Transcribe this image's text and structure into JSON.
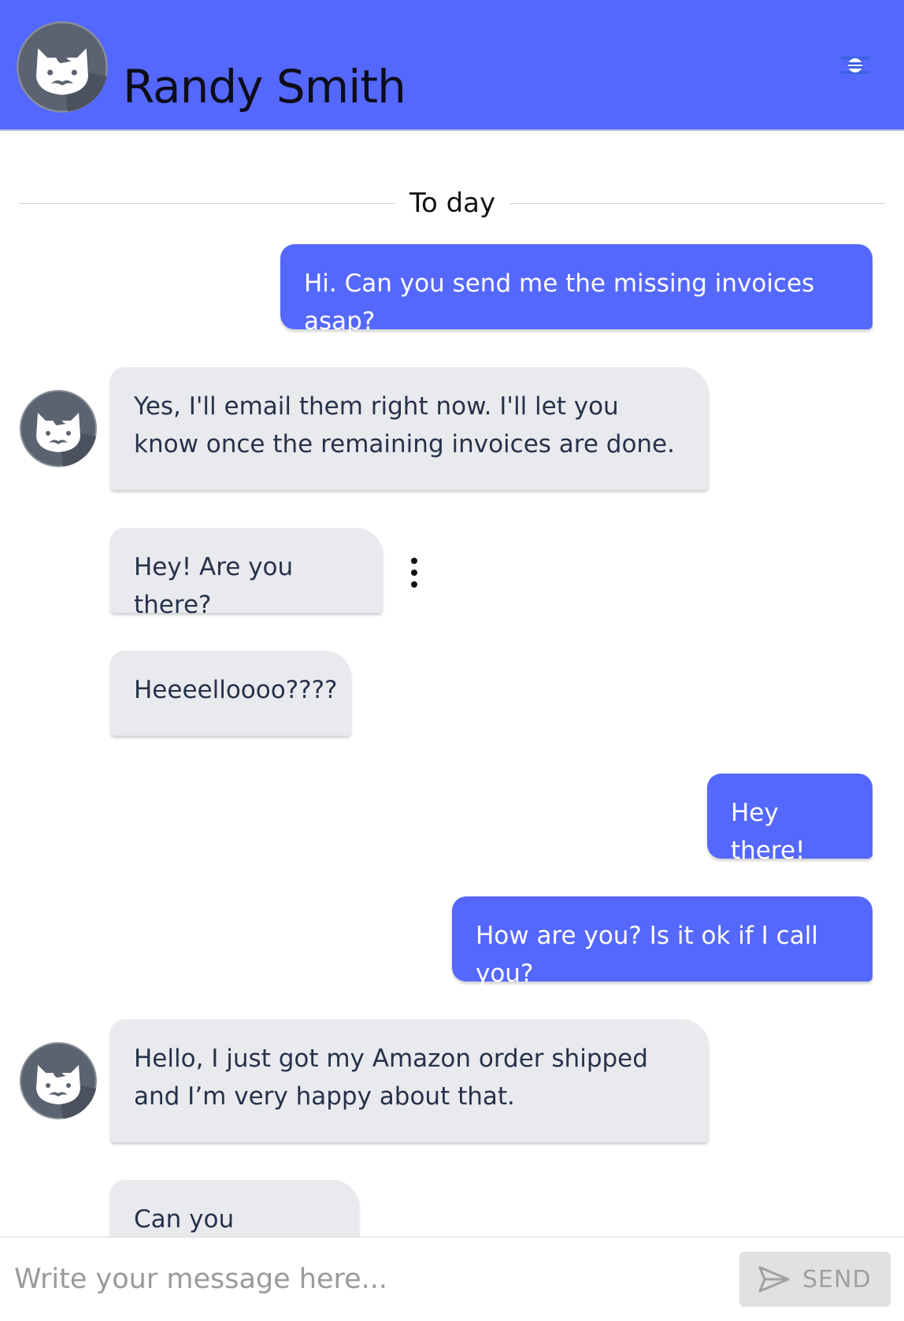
{
  "header": {
    "contact_name": "Randy Smith",
    "avatar_icon": "cat-mustache-avatar",
    "menu_icon": "hamburger-menu-icon",
    "accent": "#5568fe"
  },
  "chat": {
    "date_divider": "To day",
    "messages": [
      {
        "direction": "outgoing",
        "text": "Hi. Can you send me the missing invoices asap?"
      },
      {
        "direction": "incoming",
        "text": "Yes, I'll email them right now. I'll let you know once the remaining invoices are done.",
        "avatar": true
      },
      {
        "direction": "incoming",
        "text": "Hey! Are you there?"
      },
      {
        "direction": "incoming",
        "text": "Heeeelloooo????"
      },
      {
        "direction": "outgoing",
        "text": "Hey there!"
      },
      {
        "direction": "outgoing",
        "text": "How are you? Is it ok if I call you?"
      },
      {
        "direction": "incoming",
        "text": "Hello, I just got my Amazon order shipped and I’m very happy about that.",
        "avatar": true
      },
      {
        "direction": "incoming",
        "text": "Can you confirm?"
      }
    ],
    "incoming_bubble_color": "#e9eaee",
    "outgoing_bubble_color": "#5568fe"
  },
  "composer": {
    "placeholder": "Write your message here...",
    "value": "",
    "send_label": "SEND",
    "send_icon": "paper-plane-icon"
  }
}
